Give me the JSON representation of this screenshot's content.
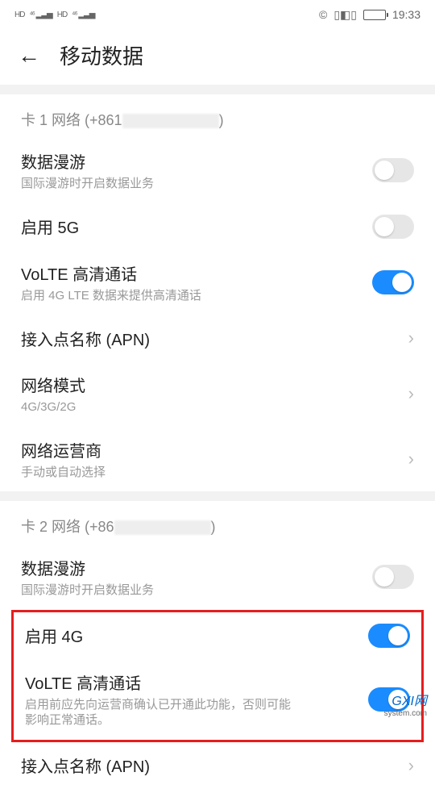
{
  "status": {
    "time": "19:33",
    "alarm_icon": "⏰",
    "vibrate_icon": "📳"
  },
  "header": {
    "title": "移动数据"
  },
  "sim1": {
    "header": "卡 1 网络 (+861",
    "header_suffix": ")",
    "roaming": {
      "title": "数据漫游",
      "sub": "国际漫游时开启数据业务",
      "on": false
    },
    "enable5g": {
      "title": "启用 5G",
      "on": false
    },
    "volte": {
      "title": "VoLTE 高清通话",
      "sub": "启用 4G LTE 数据来提供高清通话",
      "on": true
    },
    "apn": {
      "title": "接入点名称 (APN)"
    },
    "netmode": {
      "title": "网络模式",
      "sub": "4G/3G/2G"
    },
    "carrier": {
      "title": "网络运营商",
      "sub": "手动或自动选择"
    }
  },
  "sim2": {
    "header": "卡 2 网络 (+86",
    "header_suffix": ")",
    "roaming": {
      "title": "数据漫游",
      "sub": "国际漫游时开启数据业务",
      "on": false
    },
    "enable4g": {
      "title": "启用 4G",
      "on": true
    },
    "volte": {
      "title": "VoLTE 高清通话",
      "sub": "启用前应先向运营商确认已开通此功能，否则可能影响正常通话。",
      "on": true
    },
    "apn": {
      "title": "接入点名称 (APN)"
    }
  },
  "watermark": {
    "main": "GXI网",
    "sub": "system.com"
  }
}
